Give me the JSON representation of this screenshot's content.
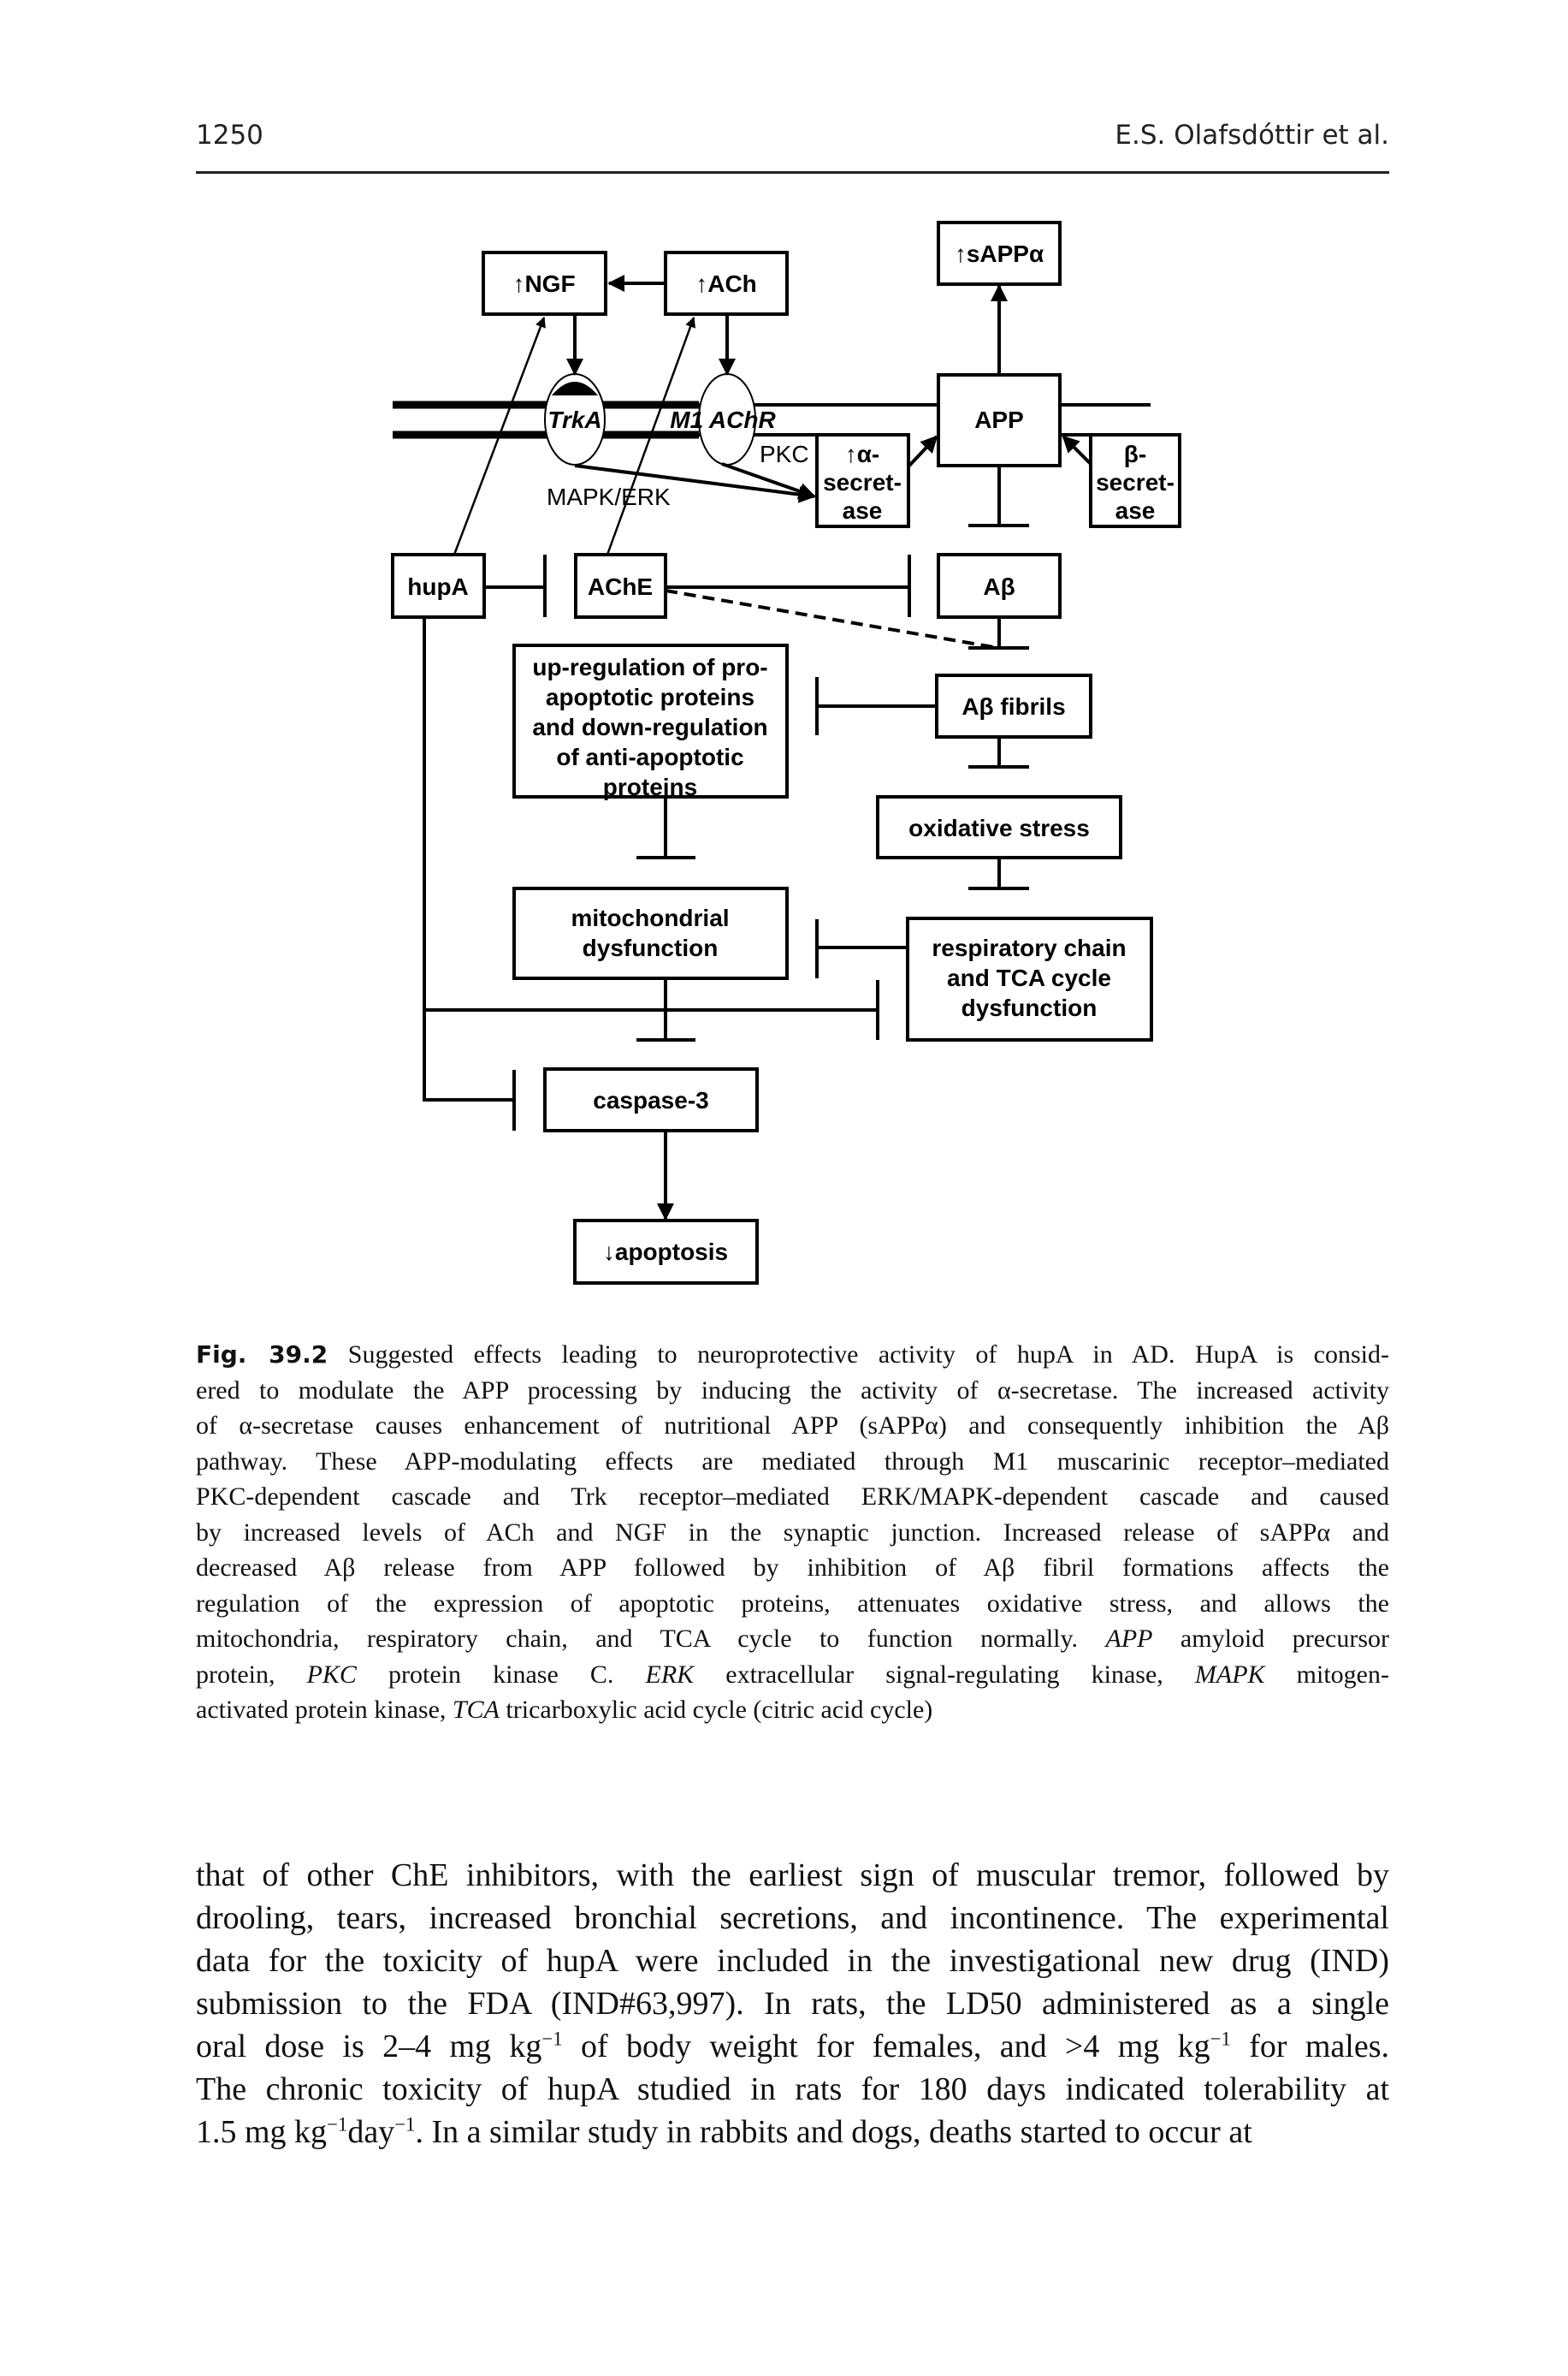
{
  "header": {
    "page_number": "1250",
    "running_head": "E.S. Olafsdóttir et al."
  },
  "figure": {
    "nodes": {
      "ngf": "↑NGF",
      "ach": "↑ACh",
      "sappa": "↑sAPPα",
      "app": "APP",
      "alpha_secretase": [
        "↑α-",
        "secret-",
        "ase"
      ],
      "beta_secretase": [
        "β-",
        "secret-",
        "ase"
      ],
      "hupa": "hupA",
      "ache": "AChE",
      "abeta": "Aβ",
      "upregulation": [
        "up-regulation of pro-",
        "apoptotic proteins",
        "and down-regulation",
        "of anti-apoptotic",
        "proteins"
      ],
      "abeta_fibrils": "Aβ fibrils",
      "oxidative_stress": "oxidative stress",
      "mitochondrial": [
        "mitochondrial",
        "dysfunction"
      ],
      "respiratory": [
        "respiratory chain",
        "and TCA cycle",
        "dysfunction"
      ],
      "caspase": "caspase-3",
      "apoptosis": "↓apoptosis"
    },
    "labels": {
      "trka": "TrkA",
      "machr": "M1 AChR",
      "pkc": "PKC",
      "mapk": "MAPK/ERK"
    }
  },
  "caption": {
    "lines": [
      [
        {
          "t": "Fig. 39.2",
          "b": true
        },
        {
          "t": "  Suggested effects leading to neuroprotective activity of hupA in AD. HupA is consid-"
        }
      ],
      [
        {
          "t": "ered to modulate the APP processing by inducing the activity of α-secretase. The increased activity"
        }
      ],
      [
        {
          "t": "of α-secretase causes enhancement of nutritional APP (sAPPα) and consequently inhibition the Aβ"
        }
      ],
      [
        {
          "t": "pathway. These APP-modulating effects are mediated through M1 muscarinic receptor–mediated"
        }
      ],
      [
        {
          "t": "PKC-dependent cascade and Trk receptor–mediated ERK/MAPK-dependent cascade and caused"
        }
      ],
      [
        {
          "t": "by increased levels of ACh and NGF in the synaptic junction. Increased release of sAPPα and"
        }
      ],
      [
        {
          "t": "decreased Aβ release from APP followed by inhibition of Aβ fibril formations affects the"
        }
      ],
      [
        {
          "t": "regulation of the expression of apoptotic proteins, attenuates oxidative stress, and allows the"
        }
      ],
      [
        {
          "t": "mitochondria, respiratory chain, and TCA cycle to function normally. "
        },
        {
          "t": "APP",
          "i": true
        },
        {
          "t": " amyloid precursor"
        }
      ],
      [
        {
          "t": "protein, "
        },
        {
          "t": "PKC",
          "i": true
        },
        {
          "t": " protein kinase C. "
        },
        {
          "t": "ERK",
          "i": true
        },
        {
          "t": " extracellular signal-regulating kinase, "
        },
        {
          "t": "MAPK",
          "i": true
        },
        {
          "t": " mitogen-"
        }
      ],
      [
        {
          "t": "activated protein kinase, "
        },
        {
          "t": "TCA",
          "i": true
        },
        {
          "t": " tricarboxylic acid cycle (citric acid cycle)"
        }
      ]
    ]
  },
  "body": {
    "lines": [
      [
        {
          "t": "that of other ChE inhibitors, with the earliest sign of muscular tremor, followed by"
        }
      ],
      [
        {
          "t": "drooling, tears, increased bronchial secretions, and incontinence. The experimental"
        }
      ],
      [
        {
          "t": "data for the toxicity of hupA were included in the investigational new drug (IND)"
        }
      ],
      [
        {
          "t": "submission to the FDA (IND#63,997). In rats, the LD50 administered as a single"
        }
      ],
      [
        {
          "t": "oral dose is 2–4 mg kg"
        },
        {
          "t": "−1",
          "sup": true
        },
        {
          "t": " of body weight for females, and >4 mg kg"
        },
        {
          "t": "−1",
          "sup": true
        },
        {
          "t": " for males."
        }
      ],
      [
        {
          "t": "The chronic toxicity of hupA studied in rats for 180 days indicated tolerability at"
        }
      ],
      [
        {
          "t": "1.5 mg kg"
        },
        {
          "t": "−1",
          "sup": true
        },
        {
          "t": "day"
        },
        {
          "t": "−1",
          "sup": true
        },
        {
          "t": ". In a similar study in rabbits and dogs, deaths started to occur at"
        }
      ]
    ]
  }
}
